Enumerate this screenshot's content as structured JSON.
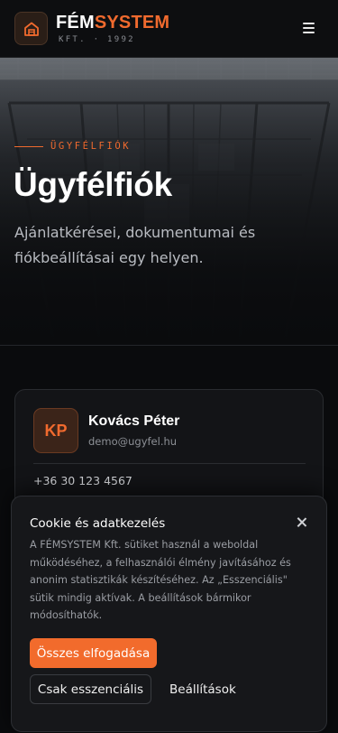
{
  "header": {
    "brand_part1": "FÉM",
    "brand_part2": "SYSTEM",
    "brand_sub": "KFT. · 1992",
    "logo_icon": "warehouse-icon",
    "menu_icon": "hamburger-menu-icon"
  },
  "hero": {
    "eyebrow": "ÜGYFÉLFIÓK",
    "title": "Ügyfélfiók",
    "description": "Ajánlatkérései, dokumentumai és fiókbeállításai egy helyen."
  },
  "profile": {
    "initials": "KP",
    "name": "Kovács Péter",
    "email": "demo@ugyfel.hu",
    "phone": "+36 30 123 4567"
  },
  "cookie": {
    "title": "Cookie és adatkezelés",
    "text": "A FÉMSYSTEM Kft. sütiket használ a weboldal működéséhez, a felhasználói élmény javításához és anonim statisztikák készítéséhez. Az „Esszenciális\" sütik mindig aktívak. A beállítások bármikor módosíthatók.",
    "accept_label": "Összes elfogadása",
    "essential_label": "Csak esszenciális",
    "settings_label": "Beállítások"
  },
  "colors": {
    "accent": "#f06a2e",
    "background": "#0a0b0d"
  }
}
